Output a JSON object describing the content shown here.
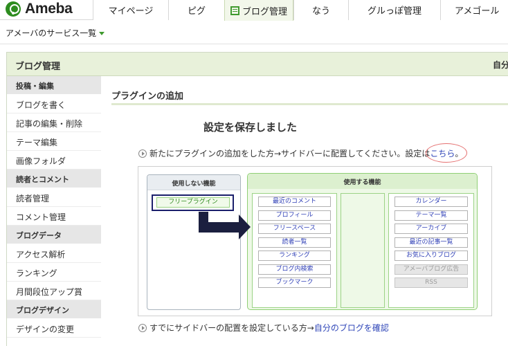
{
  "logo": {
    "text": "Ameba",
    "icon": "ameba-logo-icon"
  },
  "nav": {
    "tabs": [
      {
        "label": "マイページ"
      },
      {
        "label": "ピグ"
      },
      {
        "label": "ブログ管理",
        "active": true,
        "icon": "blog-icon"
      },
      {
        "label": "なう"
      },
      {
        "label": "グルっぽ管理"
      },
      {
        "label": "アメゴール"
      }
    ]
  },
  "services": {
    "label": "アメーバのサービス一覧"
  },
  "header": {
    "title": "ブログ管理",
    "right": "自分"
  },
  "sidebar": [
    {
      "type": "head",
      "label": "投稿・編集"
    },
    {
      "type": "item",
      "label": "ブログを書く"
    },
    {
      "type": "item",
      "label": "記事の編集・削除"
    },
    {
      "type": "item",
      "label": "テーマ編集"
    },
    {
      "type": "item",
      "label": "画像フォルダ"
    },
    {
      "type": "head",
      "label": "読者とコメント"
    },
    {
      "type": "item",
      "label": "読者管理"
    },
    {
      "type": "item",
      "label": "コメント管理"
    },
    {
      "type": "head",
      "label": "ブログデータ"
    },
    {
      "type": "item",
      "label": "アクセス解析"
    },
    {
      "type": "item",
      "label": "ランキング"
    },
    {
      "type": "item",
      "label": "月間段位アップ賞"
    },
    {
      "type": "head",
      "label": "ブログデザイン"
    },
    {
      "type": "item",
      "label": "デザインの変更"
    }
  ],
  "main": {
    "title": "プラグインの追加",
    "saved": "設定を保存しました",
    "note1_text": "新たにプラグインの追加をした方→サイドバーに配置してください。設定は",
    "note1_link": "こちら",
    "note1_end": "。",
    "note2_text": "すでにサイドバーの配置を設定している方→",
    "note2_link": "自分のブログを確認"
  },
  "diagram": {
    "unused_title": "使用しない機能",
    "used_title": "使用する機能",
    "free_plugin": "フリープラグイン",
    "col1": [
      "最近のコメント",
      "プロフィール",
      "フリースペース",
      "読者一覧",
      "ランキング",
      "ブログ内検索",
      "ブックマーク"
    ],
    "col3": [
      "カレンダー",
      "テーマ一覧",
      "アーカイブ",
      "最近の記事一覧",
      "お気に入りブログ"
    ],
    "col3_disabled": [
      "アメーバブログ広告",
      "RSS"
    ],
    "arrow_icon": "arrow-right-icon"
  }
}
